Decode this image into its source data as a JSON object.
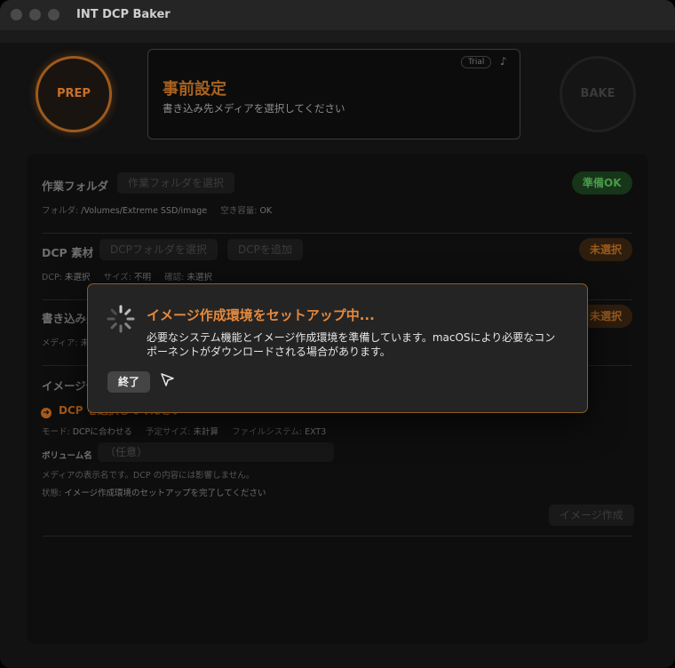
{
  "app": {
    "title": "INT DCP Baker"
  },
  "prep_button": {
    "label": "PREP"
  },
  "bake_button": {
    "label": "BAKE"
  },
  "status": {
    "title": "事前設定",
    "subtitle": "書き込み先メディアを選択してください",
    "trial_badge": "Trial",
    "icon": "note-icon"
  },
  "work_folder": {
    "title": "作業フォルダ",
    "select_button": "作業フォルダを選択",
    "status_badge": "準備OK",
    "meta": [
      {
        "label": "フォルダ:",
        "value": "/Volumes/Extreme SSD/image"
      },
      {
        "label": "空き容量:",
        "value": "OK"
      }
    ]
  },
  "dcp_source": {
    "title": "DCP 素材",
    "select_button": "DCPフォルダを選択",
    "add_button": "DCPを追加",
    "status_badge": "未選択",
    "meta": [
      {
        "label": "DCP:",
        "value": "未選択"
      },
      {
        "label": "サイズ:",
        "value": "不明"
      },
      {
        "label": "確認:",
        "value": "未選択"
      }
    ]
  },
  "write_target": {
    "title": "書き込み先",
    "status_badge": "未選択",
    "meta_label": "メディア:",
    "meta_value": "未選択"
  },
  "image_section": {
    "title": "イメージ作成",
    "dcp_line": "DCP を選択してください",
    "meta": [
      {
        "label": "モード:",
        "value": "DCPに合わせる"
      },
      {
        "label": "予定サイズ:",
        "value": "未計算"
      },
      {
        "label": "ファイルシステム:",
        "value": "EXT3"
      }
    ],
    "volume_label": "ボリューム名",
    "volume_placeholder": "（任意）",
    "help_text": "メディアの表示名です。DCP の内容には影響しません。",
    "state_label": "状態:",
    "state_value": "イメージ作成環境のセットアップを完了してください",
    "create_button": "イメージ作成"
  },
  "modal": {
    "title": "イメージ作成環境をセットアップ中...",
    "body": "必要なシステム機能とイメージ作成環境を準備しています。macOSにより必要なコンポーネントがダウンロードされる場合があります。",
    "quit_button": "終了"
  },
  "colors": {
    "accent": "#e5893d",
    "ok_green": "#4a9a4a",
    "modal_border": "#8e5a22"
  }
}
